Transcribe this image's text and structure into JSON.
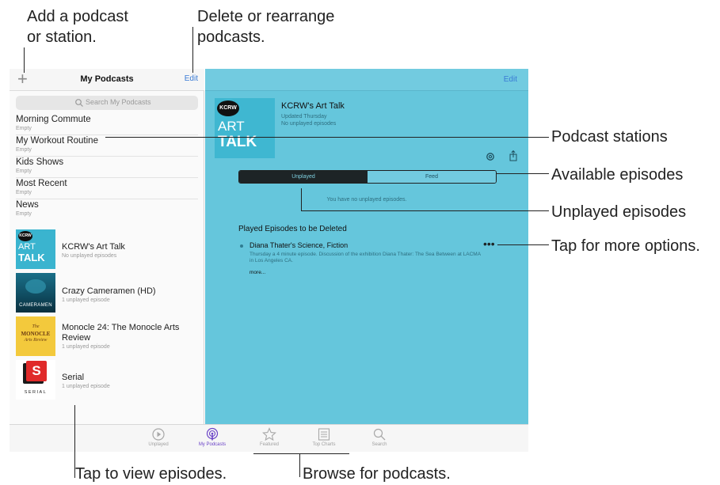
{
  "callouts": {
    "add": [
      "Add a podcast",
      "or station."
    ],
    "delete": [
      "Delete or rearrange",
      "podcasts."
    ],
    "stations": "Podcast stations",
    "available": "Available episodes",
    "unplayed": "Unplayed episodes",
    "more_options": "Tap for more options.",
    "tap_view": "Tap to view episodes.",
    "browse": "Browse for podcasts."
  },
  "left_pane": {
    "add_icon": "plus-icon",
    "title": "My Podcasts",
    "edit": "Edit",
    "search_placeholder": "Search My Podcasts",
    "stations": [
      {
        "name": "Morning Commute",
        "sub": "Empty"
      },
      {
        "name": "My Workout Routine",
        "sub": "Empty"
      },
      {
        "name": "Kids Shows",
        "sub": "Empty"
      },
      {
        "name": "Most Recent",
        "sub": "Empty"
      },
      {
        "name": "News",
        "sub": "Empty"
      }
    ],
    "podcasts": [
      {
        "title": "KCRW's Art Talk",
        "sub": "No unplayed episodes",
        "art_text": [
          "KCRW",
          "ART",
          "TALK"
        ]
      },
      {
        "title": "Crazy Cameramen (HD)",
        "sub": "1 unplayed episode",
        "art_text": [
          "CAMERAMEN"
        ]
      },
      {
        "title": "Monocle 24: The Monocle Arts Review",
        "sub": "1 unplayed episode",
        "art_text": [
          "The",
          "MONOCLE",
          "Arts Review"
        ]
      },
      {
        "title": "Serial",
        "sub": "1 unplayed episode",
        "art_text": [
          "S",
          "SERIAL"
        ]
      }
    ]
  },
  "tab_bar": {
    "tabs": [
      {
        "label": "Unplayed",
        "icon": "play-circle-icon"
      },
      {
        "label": "My Podcasts",
        "icon": "podcasts-icon"
      },
      {
        "label": "Featured",
        "icon": "star-icon"
      },
      {
        "label": "Top Charts",
        "icon": "list-icon"
      },
      {
        "label": "Search",
        "icon": "search-icon"
      }
    ],
    "active_color": "#6b44c7"
  },
  "right_pane": {
    "edit": "Edit",
    "podcast_title": "KCRW's Art Talk",
    "meta": [
      "Updated Thursday",
      "No unplayed episodes"
    ],
    "segments": [
      "Unplayed",
      "Feed"
    ],
    "empty_message": "You have no unplayed episodes.",
    "section_title": "Played Episodes to be Deleted",
    "episode": {
      "title": "Diana Thater's Science, Fiction",
      "description": "Thursday a 4 minute episode. Discussion of the exhibition Diana Thater: The Sea Between at LACMA in Los Angeles CA.",
      "more": "more..."
    },
    "background_color": "#65c6dc"
  }
}
